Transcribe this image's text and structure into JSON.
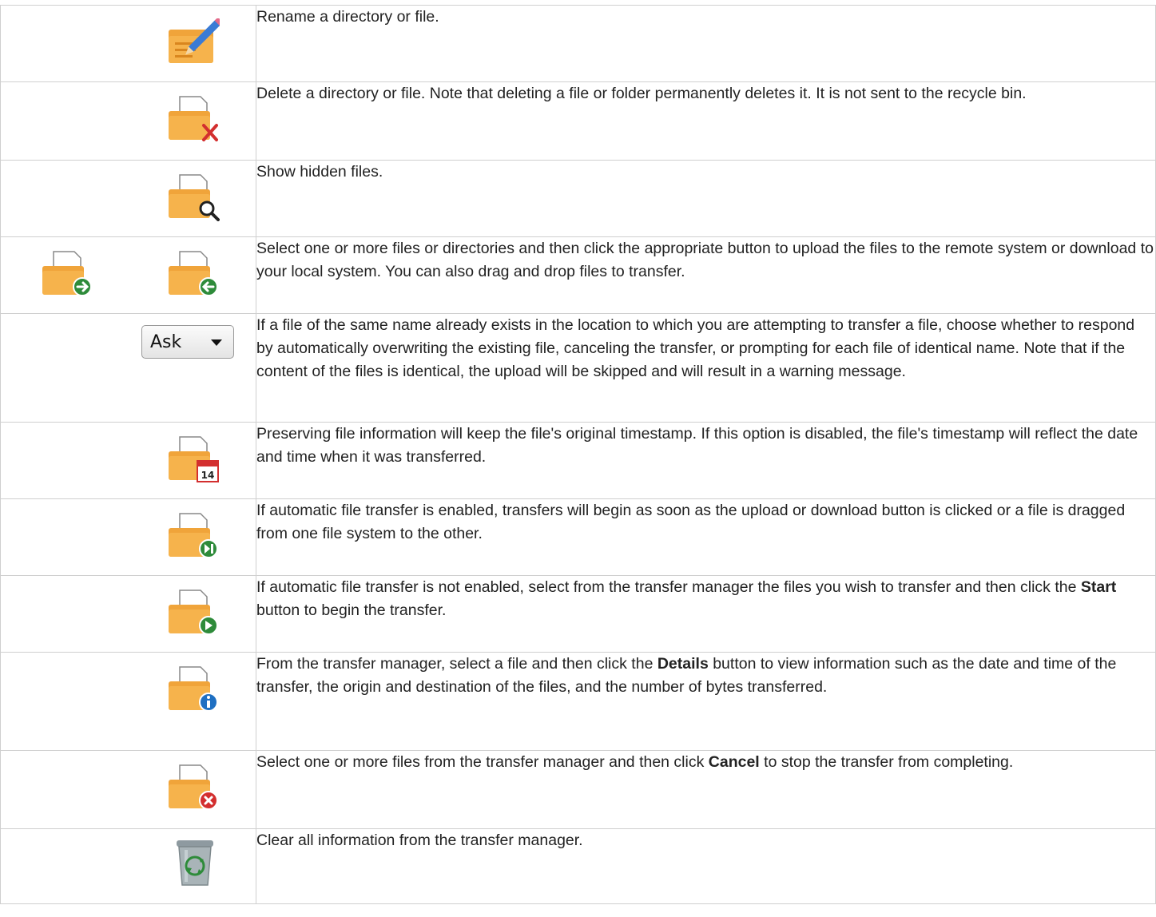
{
  "rows": [
    {
      "id": "rename",
      "icons": [
        "folder-rename-icon"
      ],
      "text": "Rename a directory or file."
    },
    {
      "id": "delete",
      "icons": [
        "folder-delete-icon"
      ],
      "text": "Delete a directory or file. Note that deleting a file or folder permanently deletes it. It is not sent to the recycle bin."
    },
    {
      "id": "hidden",
      "icons": [
        "folder-search-icon"
      ],
      "text": "Show hidden files."
    },
    {
      "id": "transfer",
      "icons": [
        "folder-upload-icon",
        "folder-download-icon"
      ],
      "text": "Select one or more files or directories and then click the appropriate button to upload the files to the remote system or download to your local system. You can also drag and drop files to transfer."
    },
    {
      "id": "ask",
      "select_value": "Ask",
      "text": "If a file of the same name already exists in the location to which you are attempting to transfer a file, choose whether to respond by automatically overwriting the existing file, canceling the transfer, or prompting for each file of identical name. Note that if the content of the files is identical, the upload will be skipped and will result in a warning message."
    },
    {
      "id": "preserve",
      "icons": [
        "folder-calendar-icon"
      ],
      "calendar_day": "14",
      "text": "Preserving file information will keep the file's original timestamp. If this option is disabled, the file's timestamp will reflect the date and time when it was transferred."
    },
    {
      "id": "auto",
      "icons": [
        "folder-auto-transfer-icon"
      ],
      "text": "If automatic file transfer is enabled, transfers will begin as soon as the upload or download button is clicked or a file is dragged from one file system to the other."
    },
    {
      "id": "start",
      "icons": [
        "folder-start-icon"
      ],
      "text_before": "If automatic file transfer is not enabled, select from the transfer manager the files you wish to transfer and then click the ",
      "bold": "Start",
      "text_after": " button to begin the transfer."
    },
    {
      "id": "details",
      "icons": [
        "folder-info-icon"
      ],
      "text_before": "From the transfer manager, select a file and then click the ",
      "bold": "Details",
      "text_after": " button to view information such as the date and time of the transfer, the origin and destination of the files, and the number of bytes transferred."
    },
    {
      "id": "cancel",
      "icons": [
        "folder-cancel-icon"
      ],
      "text_before": "Select one or more files from the transfer manager and then click ",
      "bold": "Cancel",
      "text_after": " to stop the transfer from completing."
    },
    {
      "id": "clear",
      "icons": [
        "recycle-bin-icon"
      ],
      "text": "Clear all information from the transfer manager."
    }
  ],
  "colors": {
    "folder": "#f0a43a",
    "folder_dark": "#d9861e",
    "green": "#2e8b3a",
    "red": "#d32f2f",
    "blue": "#1e6fc2",
    "border": "#cfcfcf"
  }
}
